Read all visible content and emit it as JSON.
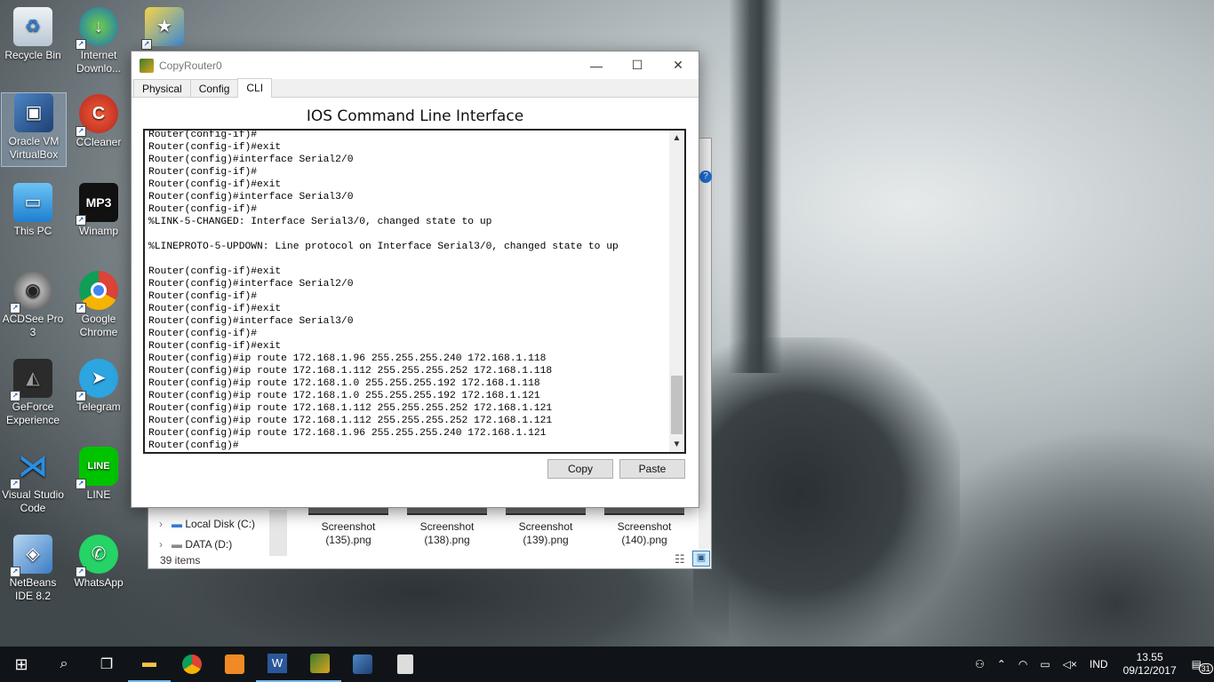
{
  "desktop_icons": [
    {
      "label": "Recycle Bin",
      "icon": "recycle-bin-icon"
    },
    {
      "label": "Internet Downlo...",
      "icon": "internet-download-manager-icon"
    },
    {
      "label": "",
      "icon": "app-shortcut-icon"
    },
    {
      "label": "Oracle VM VirtualBox",
      "icon": "virtualbox-icon"
    },
    {
      "label": "CCleaner",
      "icon": "ccleaner-icon"
    },
    {
      "label": "This PC",
      "icon": "this-pc-icon"
    },
    {
      "label": "Winamp",
      "icon": "winamp-icon"
    },
    {
      "label": "ACDSee Pro 3",
      "icon": "acdsee-icon"
    },
    {
      "label": "Google Chrome",
      "icon": "chrome-icon"
    },
    {
      "label": "GeForce Experience",
      "icon": "geforce-icon"
    },
    {
      "label": "Telegram",
      "icon": "telegram-icon"
    },
    {
      "label": "Visual Studio Code",
      "icon": "vscode-icon"
    },
    {
      "label": "LINE",
      "icon": "line-icon"
    },
    {
      "label": "NetBeans IDE 8.2",
      "icon": "netbeans-icon"
    },
    {
      "label": "WhatsApp",
      "icon": "whatsapp-icon"
    }
  ],
  "explorer": {
    "nav": [
      "Local Disk (C:)",
      "DATA (D:)"
    ],
    "thumbnails": [
      "Screenshot (135).png",
      "Screenshot (138).png",
      "Screenshot (139).png",
      "Screenshot (140).png"
    ],
    "status": "39 items"
  },
  "window": {
    "title": "CopyRouter0",
    "tabs": [
      "Physical",
      "Config",
      "CLI"
    ],
    "active_tab": "CLI",
    "cli_title": "IOS Command Line Interface",
    "terminal_lines": [
      "Router(config-if)#",
      "Router(config-if)#exit",
      "Router(config)#interface Serial2/0",
      "Router(config-if)#",
      "Router(config-if)#exit",
      "Router(config)#interface Serial3/0",
      "Router(config-if)#",
      "%LINK-5-CHANGED: Interface Serial3/0, changed state to up",
      "",
      "%LINEPROTO-5-UPDOWN: Line protocol on Interface Serial3/0, changed state to up",
      "",
      "Router(config-if)#exit",
      "Router(config)#interface Serial2/0",
      "Router(config-if)#",
      "Router(config-if)#exit",
      "Router(config)#interface Serial3/0",
      "Router(config-if)#",
      "Router(config-if)#exit",
      "Router(config)#ip route 172.168.1.96 255.255.255.240 172.168.1.118",
      "Router(config)#ip route 172.168.1.112 255.255.255.252 172.168.1.118",
      "Router(config)#ip route 172.168.1.0 255.255.255.192 172.168.1.118",
      "Router(config)#ip route 172.168.1.0 255.255.255.192 172.168.1.121",
      "Router(config)#ip route 172.168.1.112 255.255.255.252 172.168.1.121",
      "Router(config)#ip route 172.168.1.112 255.255.255.252 172.168.1.121",
      "Router(config)#ip route 172.168.1.96 255.255.255.240 172.168.1.121",
      "Router(config)#"
    ],
    "copy_label": "Copy",
    "paste_label": "Paste"
  },
  "taskbar": {
    "items": [
      "start-icon",
      "search-icon",
      "task-view-icon",
      "file-explorer-icon",
      "chrome-icon",
      "pdf-app-icon",
      "word-icon",
      "packet-tracer-icon",
      "virtualbox-icon",
      "calculator-icon"
    ],
    "language": "IND",
    "time": "13.55",
    "date": "09/12/2017",
    "notification_count": "31"
  }
}
